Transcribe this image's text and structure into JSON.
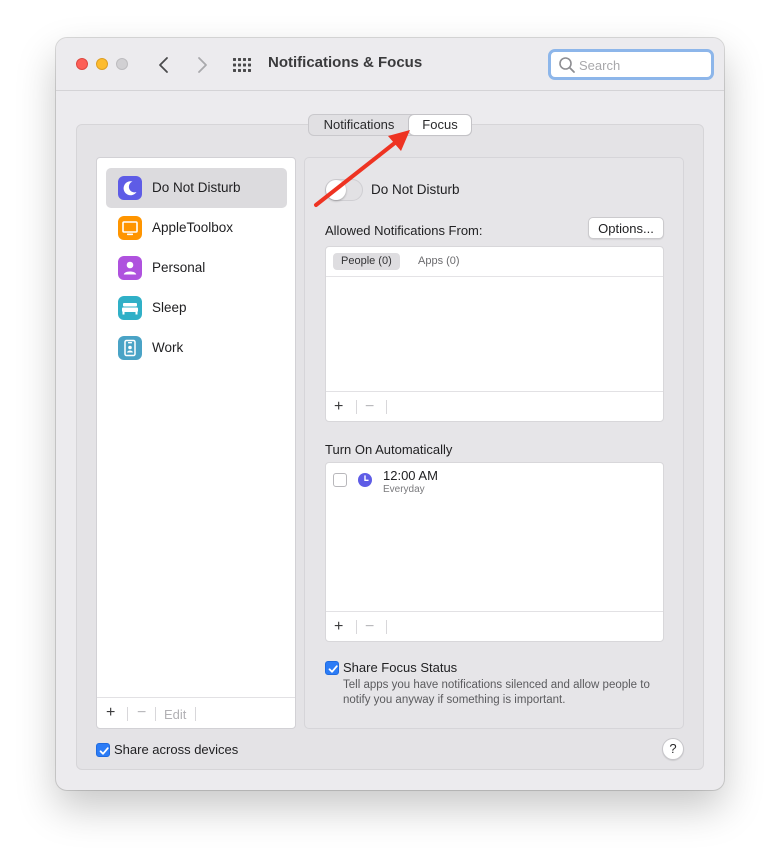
{
  "window": {
    "title": "Notifications & Focus"
  },
  "search": {
    "placeholder": "Search",
    "value": ""
  },
  "tabs": [
    {
      "label": "Notifications",
      "selected": false
    },
    {
      "label": "Focus",
      "selected": true
    }
  ],
  "focus_list": {
    "items": [
      {
        "label": "Do Not Disturb",
        "icon": "moon-icon",
        "color": "#5e5ce6",
        "selected": true
      },
      {
        "label": "AppleToolbox",
        "icon": "monitor-icon",
        "color": "#ff9500",
        "selected": false
      },
      {
        "label": "Personal",
        "icon": "person-icon",
        "color": "#af52de",
        "selected": false
      },
      {
        "label": "Sleep",
        "icon": "bed-icon",
        "color": "#30b0c7",
        "selected": false
      },
      {
        "label": "Work",
        "icon": "badge-icon",
        "color": "#4aa3c6",
        "selected": false
      }
    ],
    "toolbar": {
      "add_label": "+",
      "remove_label": "−",
      "edit_label": "Edit"
    }
  },
  "detail": {
    "toggle_label": "Do Not Disturb",
    "toggle_on": false,
    "allowed_label": "Allowed Notifications From:",
    "options_label": "Options...",
    "allowed_tabs": {
      "people": "People (0)",
      "apps": "Apps (0)"
    },
    "turn_on_label": "Turn On Automatically",
    "schedule": [
      {
        "time": "12:00 AM",
        "repeat": "Everyday",
        "enabled": false
      }
    ],
    "panel_add": "+",
    "panel_remove": "−",
    "share_focus_label": "Share Focus Status",
    "share_focus_checked": true,
    "share_focus_desc": "Tell apps you have notifications silenced and allow people to notify you anyway if something is important."
  },
  "footer": {
    "share_devices_label": "Share across devices",
    "share_devices_checked": true,
    "help_label": "?"
  },
  "colors": {
    "accent": "#2c7cf6",
    "annotation_arrow": "#ee3322"
  }
}
